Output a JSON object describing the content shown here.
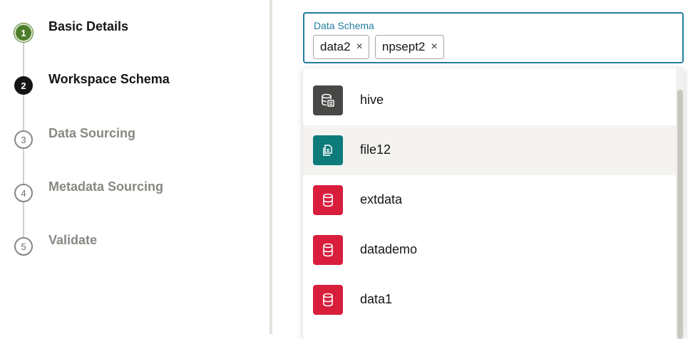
{
  "steps": [
    {
      "number": "1",
      "label": "Basic Details",
      "state": "done"
    },
    {
      "number": "2",
      "label": "Workspace Schema",
      "state": "active"
    },
    {
      "number": "3",
      "label": "Data Sourcing",
      "state": "todo"
    },
    {
      "number": "4",
      "label": "Metadata Sourcing",
      "state": "todo"
    },
    {
      "number": "5",
      "label": "Validate",
      "state": "todo"
    }
  ],
  "data_schema": {
    "label": "Data Schema",
    "selected": [
      {
        "label": "data2",
        "remove": "×"
      },
      {
        "label": "npsept2",
        "remove": "×"
      }
    ]
  },
  "dropdown": {
    "options": [
      {
        "label": "hive",
        "icon": "hive-database-icon",
        "color": "#4a4846"
      },
      {
        "label": "file12",
        "icon": "file-icon",
        "color": "#0e7b7b"
      },
      {
        "label": "extdata",
        "icon": "database-icon",
        "color": "#d91e3c"
      },
      {
        "label": "datademo",
        "icon": "database-icon",
        "color": "#d91e3c"
      },
      {
        "label": "data1",
        "icon": "database-icon",
        "color": "#d91e3c"
      }
    ]
  },
  "colors": {
    "accent": "#227e9e",
    "done": "#4d7e2b",
    "active": "#161513",
    "muted": "#8a8782"
  }
}
